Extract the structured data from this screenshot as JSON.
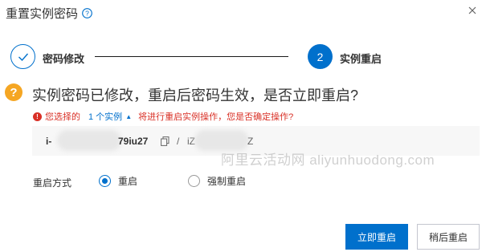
{
  "dialog": {
    "title": "重置实例密码"
  },
  "steps": [
    {
      "label": "密码修改",
      "state": "done"
    },
    {
      "number": "2",
      "label": "实例重启",
      "state": "active"
    }
  ],
  "question": {
    "icon_glyph": "?",
    "text": "实例密码已修改，重启后密码生效，是否立即重启?"
  },
  "warning": {
    "prefix": "您选择的",
    "count": "1 个实例",
    "suffix": "将进行重启实例操作，您是否确定操作?"
  },
  "instance": {
    "id_start": "i-",
    "id_end": "79iu27",
    "separator": "/",
    "name_start": "iZ",
    "name_end": "Z"
  },
  "watermark": "阿里云活动网 aliyunhuodong.com",
  "restart_mode": {
    "label": "重启方式",
    "options": [
      {
        "label": "重启",
        "selected": true
      },
      {
        "label": "强制重启",
        "selected": false
      }
    ]
  },
  "buttons": {
    "confirm": "立即重启",
    "later": "稍后重启"
  },
  "colors": {
    "primary": "#0070cc",
    "warning_text": "#d93026",
    "question_icon": "#f5a623"
  }
}
